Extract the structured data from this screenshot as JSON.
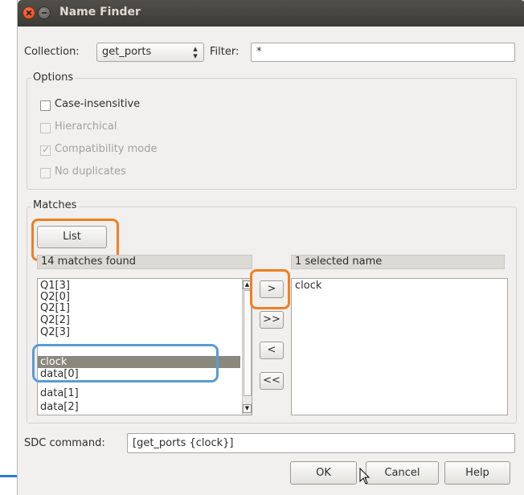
{
  "window": {
    "title": "Name Finder"
  },
  "collection": {
    "label": "Collection:",
    "value": "get_ports"
  },
  "filter": {
    "label": "Filter:",
    "value": "*"
  },
  "options": {
    "title": "Options",
    "items": [
      {
        "label": "Case-insensitive",
        "checked": false,
        "enabled": true
      },
      {
        "label": "Hierarchical",
        "checked": false,
        "enabled": false
      },
      {
        "label": "Compatibility mode",
        "checked": true,
        "enabled": false
      },
      {
        "label": "No duplicates",
        "checked": false,
        "enabled": false
      }
    ]
  },
  "matches": {
    "title": "Matches",
    "list_button": "List",
    "found_header": "14 matches found",
    "selected_header": "1 selected name",
    "items": [
      "Q1[3]",
      "Q2[0]",
      "Q2[1]",
      "Q2[2]",
      "Q2[3]",
      "clock",
      "data[0]",
      "data[1]",
      "data[2]"
    ],
    "selected_item": "clock",
    "selected_names": [
      "clock"
    ],
    "move_buttons": {
      "add": ">",
      "add_all": ">>",
      "remove": "<",
      "remove_all": "<<"
    }
  },
  "sdc": {
    "label": "SDC command:",
    "value": "[get_ports {clock}]"
  },
  "footer": {
    "ok": "OK",
    "cancel": "Cancel",
    "help": "Help"
  },
  "colors": {
    "titlebar": "#3d3b37",
    "selection": "#8a877d",
    "highlight_orange": "#ef7f22",
    "highlight_blue": "#5a9bd5"
  }
}
